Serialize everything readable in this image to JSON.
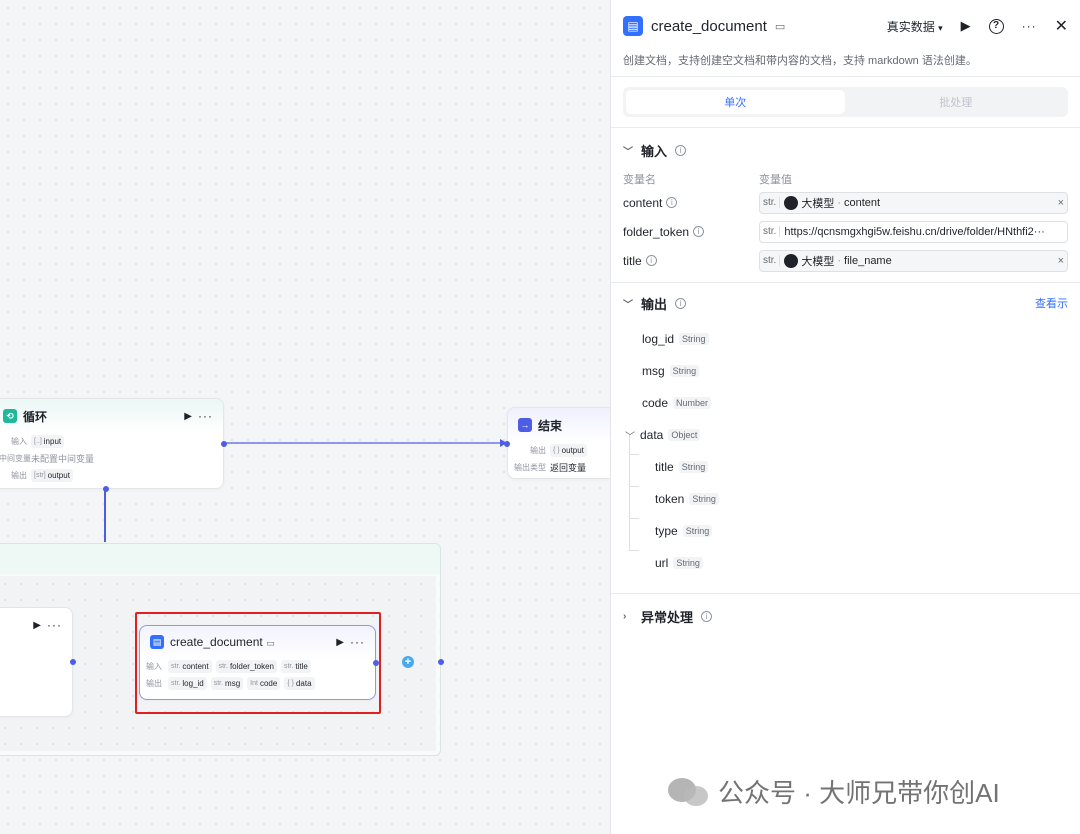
{
  "loop_node": {
    "title": "循环",
    "input_label": "输入",
    "input_type": "[..]",
    "input_value": "input",
    "mid_label": "中间变量",
    "mid_value": "未配置中间变量",
    "output_label": "输出",
    "output_type": "[str]",
    "output_value": "output"
  },
  "end_node": {
    "title": "结束",
    "output_label": "输出",
    "output_type": "{ }",
    "output_value": "output",
    "output_type_label": "输出类型",
    "output_type_value": "返回变量"
  },
  "doc_node": {
    "title": "create_document",
    "input_label": "输入",
    "inputs": [
      {
        "type": "str.",
        "name": "content"
      },
      {
        "type": "str.",
        "name": "folder_token"
      },
      {
        "type": "str.",
        "name": "title"
      }
    ],
    "output_label": "输出",
    "outputs": [
      {
        "type": "str.",
        "name": "log_id"
      },
      {
        "type": "str.",
        "name": "msg"
      },
      {
        "type": "Int",
        "name": "code"
      },
      {
        "type": "{ }",
        "name": "data"
      }
    ]
  },
  "panel": {
    "title": "create_document",
    "data_mode": "真实数据",
    "description": "创建文档，支持创建空文档和带内容的文档，支持 markdown 语法创建。",
    "tabs": [
      "单次",
      "批处理"
    ],
    "input_section": "输入",
    "col_name": "变量名",
    "col_value": "变量值",
    "inputs": [
      {
        "name": "content",
        "type": "str.",
        "source": "大模型",
        "var": "content"
      },
      {
        "name": "folder_token",
        "type": "str.",
        "value": "https://qcnsmgxhgi5w.feishu.cn/drive/folder/HNthfi2···"
      },
      {
        "name": "title",
        "type": "str.",
        "source": "大模型",
        "var": "file_name"
      }
    ],
    "output_section": "输出",
    "view_example": "查看示",
    "outputs": [
      {
        "name": "log_id",
        "type": "String"
      },
      {
        "name": "msg",
        "type": "String"
      },
      {
        "name": "code",
        "type": "Number"
      },
      {
        "name": "data",
        "type": "Object"
      }
    ],
    "data_children": [
      {
        "name": "title",
        "type": "String"
      },
      {
        "name": "token",
        "type": "String"
      },
      {
        "name": "type",
        "type": "String"
      },
      {
        "name": "url",
        "type": "String"
      }
    ],
    "error_section": "异常处理"
  },
  "watermark": "公众号 · 大师兄带你创AI",
  "colors": {
    "accent": "#4e5ee4",
    "highlight": "#e02020",
    "link": "#3370ff"
  }
}
